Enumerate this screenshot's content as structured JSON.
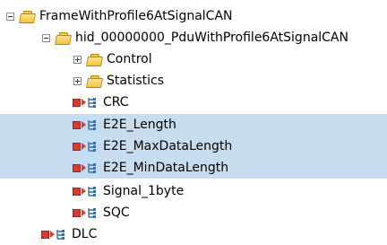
{
  "tree": {
    "frame": {
      "label": "FrameWithProfile6AtSignalCAN",
      "expanded": true
    },
    "pdu": {
      "label": "hid_00000000_PduWithProfile6AtSignalCAN",
      "expanded": true
    },
    "folders": [
      {
        "label": "Control",
        "expanded": false
      },
      {
        "label": "Statistics",
        "expanded": false
      }
    ],
    "signals": [
      {
        "label": "CRC",
        "selected": false
      },
      {
        "label": "E2E_Length",
        "selected": true
      },
      {
        "label": "E2E_MaxDataLength",
        "selected": true
      },
      {
        "label": "E2E_MinDataLength",
        "selected": true
      },
      {
        "label": "Signal_1byte",
        "selected": false
      },
      {
        "label": "SQC",
        "selected": false
      }
    ],
    "frame_signal": {
      "label": "DLC",
      "selected": false
    }
  },
  "colors": {
    "selection": "#c6dcf0",
    "signal_red": "#d83b2b",
    "folder_yellow": "#f2c23a",
    "signal_icon_blue": "#3a6ea5"
  }
}
